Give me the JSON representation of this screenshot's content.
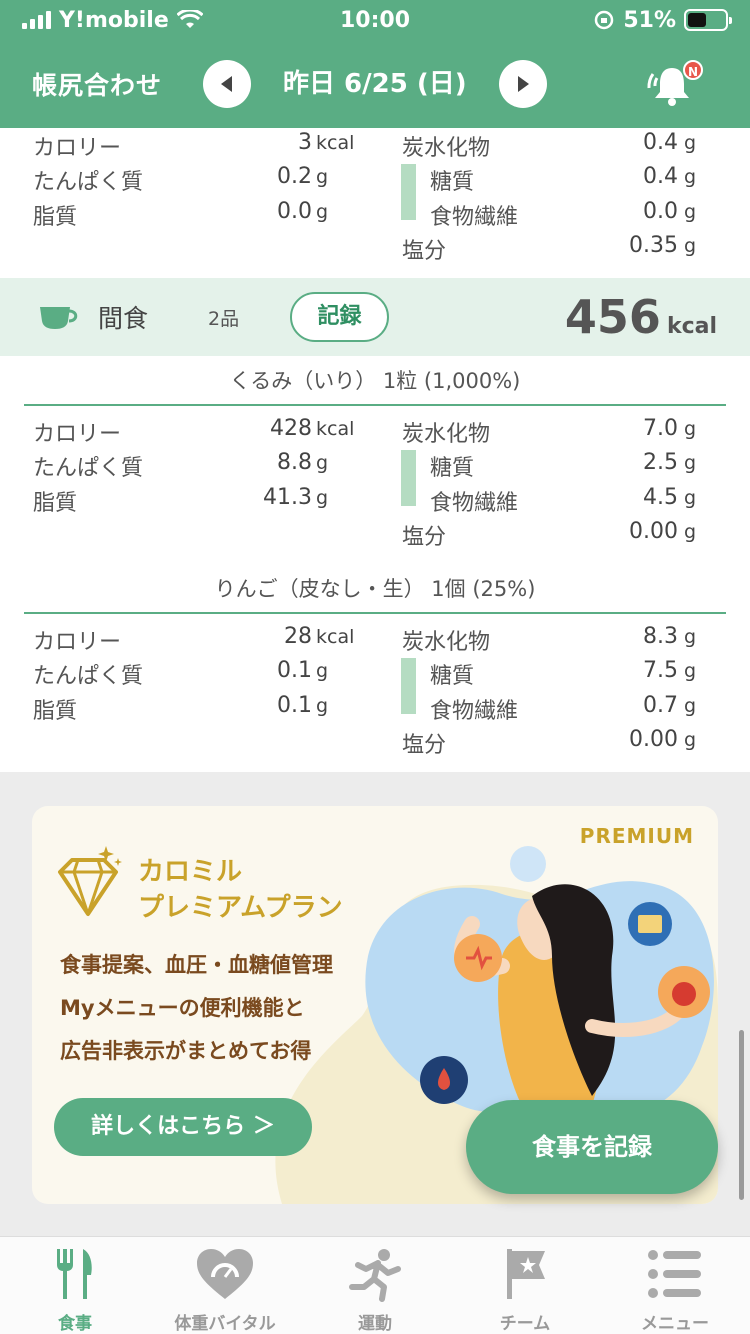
{
  "status": {
    "carrier": "Y!mobile",
    "time": "10:00",
    "battery": "51%"
  },
  "header": {
    "brand": "帳尻合わせ",
    "date": "昨日 6/25 (日)",
    "badge": "N"
  },
  "prev_nutrition": {
    "cal_label": "カロリー",
    "cal_val": "3",
    "cal_unit": "kcal",
    "pro_label": "たんぱく質",
    "pro_val": "0.2",
    "pro_unit": "g",
    "fat_label": "脂質",
    "fat_val": "0.0",
    "fat_unit": "g",
    "carb_label": "炭水化物",
    "carb_val": "0.4",
    "carb_unit": "g",
    "sugar_label": "糖質",
    "sugar_val": "0.4",
    "sugar_unit": "g",
    "fiber_label": "食物繊維",
    "fiber_val": "0.0",
    "fiber_unit": "g",
    "salt_label": "塩分",
    "salt_val": "0.35",
    "salt_unit": "g"
  },
  "meal": {
    "name": "間食",
    "count": "2品",
    "record_label": "記録",
    "kcal": "456",
    "kcal_unit": "kcal"
  },
  "foods": [
    {
      "title": "くるみ（いり） 1粒 (1,000%)",
      "cal_label": "カロリー",
      "cal_val": "428",
      "cal_unit": "kcal",
      "pro_label": "たんぱく質",
      "pro_val": "8.8",
      "pro_unit": "g",
      "fat_label": "脂質",
      "fat_val": "41.3",
      "fat_unit": "g",
      "carb_label": "炭水化物",
      "carb_val": "7.0",
      "carb_unit": "g",
      "sugar_label": "糖質",
      "sugar_val": "2.5",
      "sugar_unit": "g",
      "fiber_label": "食物繊維",
      "fiber_val": "4.5",
      "fiber_unit": "g",
      "salt_label": "塩分",
      "salt_val": "0.00",
      "salt_unit": "g"
    },
    {
      "title": "りんご（皮なし・生） 1個 (25%)",
      "cal_label": "カロリー",
      "cal_val": "28",
      "cal_unit": "kcal",
      "pro_label": "たんぱく質",
      "pro_val": "0.1",
      "pro_unit": "g",
      "fat_label": "脂質",
      "fat_val": "0.1",
      "fat_unit": "g",
      "carb_label": "炭水化物",
      "carb_val": "8.3",
      "carb_unit": "g",
      "sugar_label": "糖質",
      "sugar_val": "7.5",
      "sugar_unit": "g",
      "fiber_label": "食物繊維",
      "fiber_val": "0.7",
      "fiber_unit": "g",
      "salt_label": "塩分",
      "salt_val": "0.00",
      "salt_unit": "g"
    }
  ],
  "promo": {
    "badge": "PREMIUM",
    "title_line1": "カロミル",
    "title_line2": "プレミアムプラン",
    "desc_line1": "食事提案、血圧・血糖値管理",
    "desc_line2": "Myメニューの便利機能と",
    "desc_line3": "広告非表示がまとめてお得",
    "more_label": "詳しくはこちら ＞"
  },
  "record_button": "食事を記録",
  "tabs": [
    {
      "label": "食事",
      "icon": "fork-knife-icon"
    },
    {
      "label": "体重バイタル",
      "icon": "heart-scale-icon"
    },
    {
      "label": "運動",
      "icon": "runner-icon"
    },
    {
      "label": "チーム",
      "icon": "flag-icon"
    },
    {
      "label": "メニュー",
      "icon": "menu-list-icon"
    }
  ],
  "colors": {
    "primary": "#5aad84",
    "accent_gold": "#c9a22a",
    "meal_header_bg": "#e4f2ea",
    "bar": "#b5dcc2"
  }
}
